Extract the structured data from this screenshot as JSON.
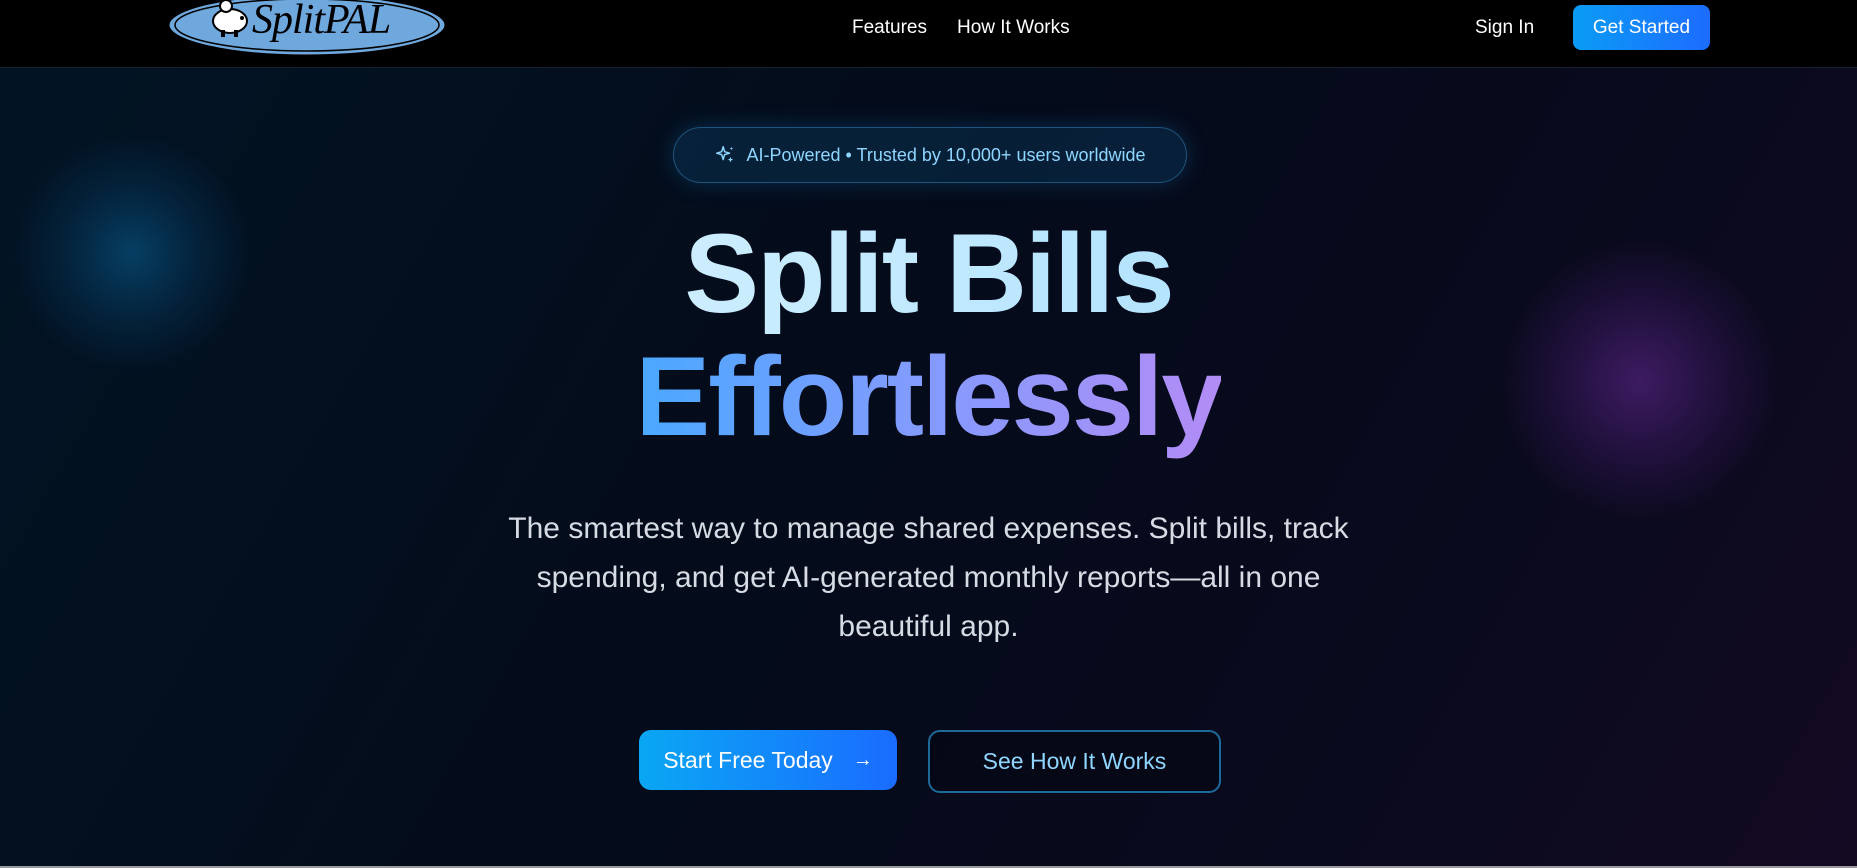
{
  "navbar": {
    "logo_text": "SplitPAL",
    "links": [
      {
        "label": "Features"
      },
      {
        "label": "How It Works"
      }
    ],
    "sign_in": "Sign In",
    "get_started": "Get Started"
  },
  "hero": {
    "badge": {
      "icon": "sparkle-icon",
      "text": "AI-Powered • Trusted by 10,000+ users worldwide"
    },
    "title_line1": "Split Bills",
    "title_line2": "Effortlessly",
    "subtitle": "The smartest way to manage shared expenses. Split bills, track spending, and get AI-generated monthly reports—all in one beautiful app.",
    "primary_button": "Start Free Today",
    "primary_button_icon": "arrow-right-icon",
    "secondary_button": "See How It Works"
  },
  "colors": {
    "accent_blue": "#1d6cff",
    "accent_cyan": "#0aa7f3",
    "badge_text": "#8fd6ff",
    "background": "#040b1a"
  }
}
